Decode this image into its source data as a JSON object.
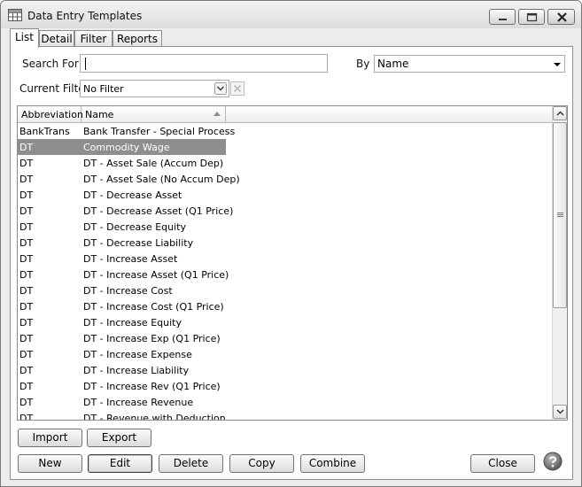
{
  "window": {
    "title": "Data Entry Templates",
    "icon": "grid-table-icon",
    "controls": [
      "minimize-icon",
      "maximize-icon",
      "close-icon"
    ]
  },
  "tabs": [
    {
      "label": "List",
      "active": true
    },
    {
      "label": "Detail",
      "active": false
    },
    {
      "label": "Filter",
      "active": false
    },
    {
      "label": "Reports",
      "active": false
    }
  ],
  "search": {
    "label": "Search For",
    "value": "",
    "by_label": "By",
    "by_value": "Name"
  },
  "filter": {
    "label": "Current Filter",
    "value": "No Filter"
  },
  "grid": {
    "columns": [
      "Abbreviation",
      "Name"
    ],
    "sorted_column": "Name",
    "selected_row": 1,
    "rows": [
      [
        "BankTrans",
        "Bank Transfer - Special Process"
      ],
      [
        "DT",
        "Commodity Wage"
      ],
      [
        "DT",
        "DT - Asset Sale (Accum Dep)"
      ],
      [
        "DT",
        "DT - Asset Sale (No Accum Dep)"
      ],
      [
        "DT",
        "DT - Decrease Asset"
      ],
      [
        "DT",
        "DT - Decrease Asset (Q1 Price)"
      ],
      [
        "DT",
        "DT - Decrease Equity"
      ],
      [
        "DT",
        "DT - Decrease Liability"
      ],
      [
        "DT",
        "DT - Increase Asset"
      ],
      [
        "DT",
        "DT - Increase Asset (Q1 Price)"
      ],
      [
        "DT",
        "DT - Increase Cost"
      ],
      [
        "DT",
        "DT - Increase Cost (Q1 Price)"
      ],
      [
        "DT",
        "DT - Increase Equity"
      ],
      [
        "DT",
        "DT - Increase Exp (Q1 Price)"
      ],
      [
        "DT",
        "DT - Increase Expense"
      ],
      [
        "DT",
        "DT - Increase Liability"
      ],
      [
        "DT",
        "DT - Increase Rev (Q1 Price)"
      ],
      [
        "DT",
        "DT - Increase Revenue"
      ],
      [
        "DT",
        "DT - Revenue with Deduction"
      ]
    ]
  },
  "buttons": {
    "import": "Import",
    "export": "Export",
    "new": "New",
    "edit": "Edit",
    "delete": "Delete",
    "copy": "Copy",
    "combine": "Combine",
    "close": "Close"
  },
  "colors": {
    "selection": "#8e8e8e",
    "window_bg": "#ececec"
  }
}
